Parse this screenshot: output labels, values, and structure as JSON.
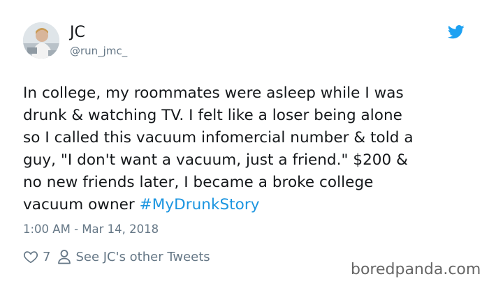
{
  "user": {
    "display_name": "JC",
    "handle": "@run_jmc_",
    "avatar_icon": "profile-photo"
  },
  "tweet": {
    "lines": [
      "In college, my roommates were asleep while I was",
      "drunk & watching TV. I felt like a loser being alone",
      "so I called this vacuum infomercial number & told a",
      "guy, \"I don't want a vacuum, just a friend.\" $200 &",
      "no new friends later, I became a broke college",
      "vacuum owner "
    ],
    "hashtag": "#MyDrunkStory",
    "timestamp": "1:00 AM - Mar 14, 2018"
  },
  "actions": {
    "like_icon": "heart-icon",
    "like_count": "7",
    "profile_icon": "person-icon",
    "other_tweets_label": "See JC's other Tweets"
  },
  "branding": {
    "platform_icon": "twitter-bird-icon",
    "watermark": "boredpanda.com"
  },
  "colors": {
    "text": "#14171a",
    "muted": "#657786",
    "link": "#1b95e0",
    "twitter_blue": "#1da1f2"
  }
}
